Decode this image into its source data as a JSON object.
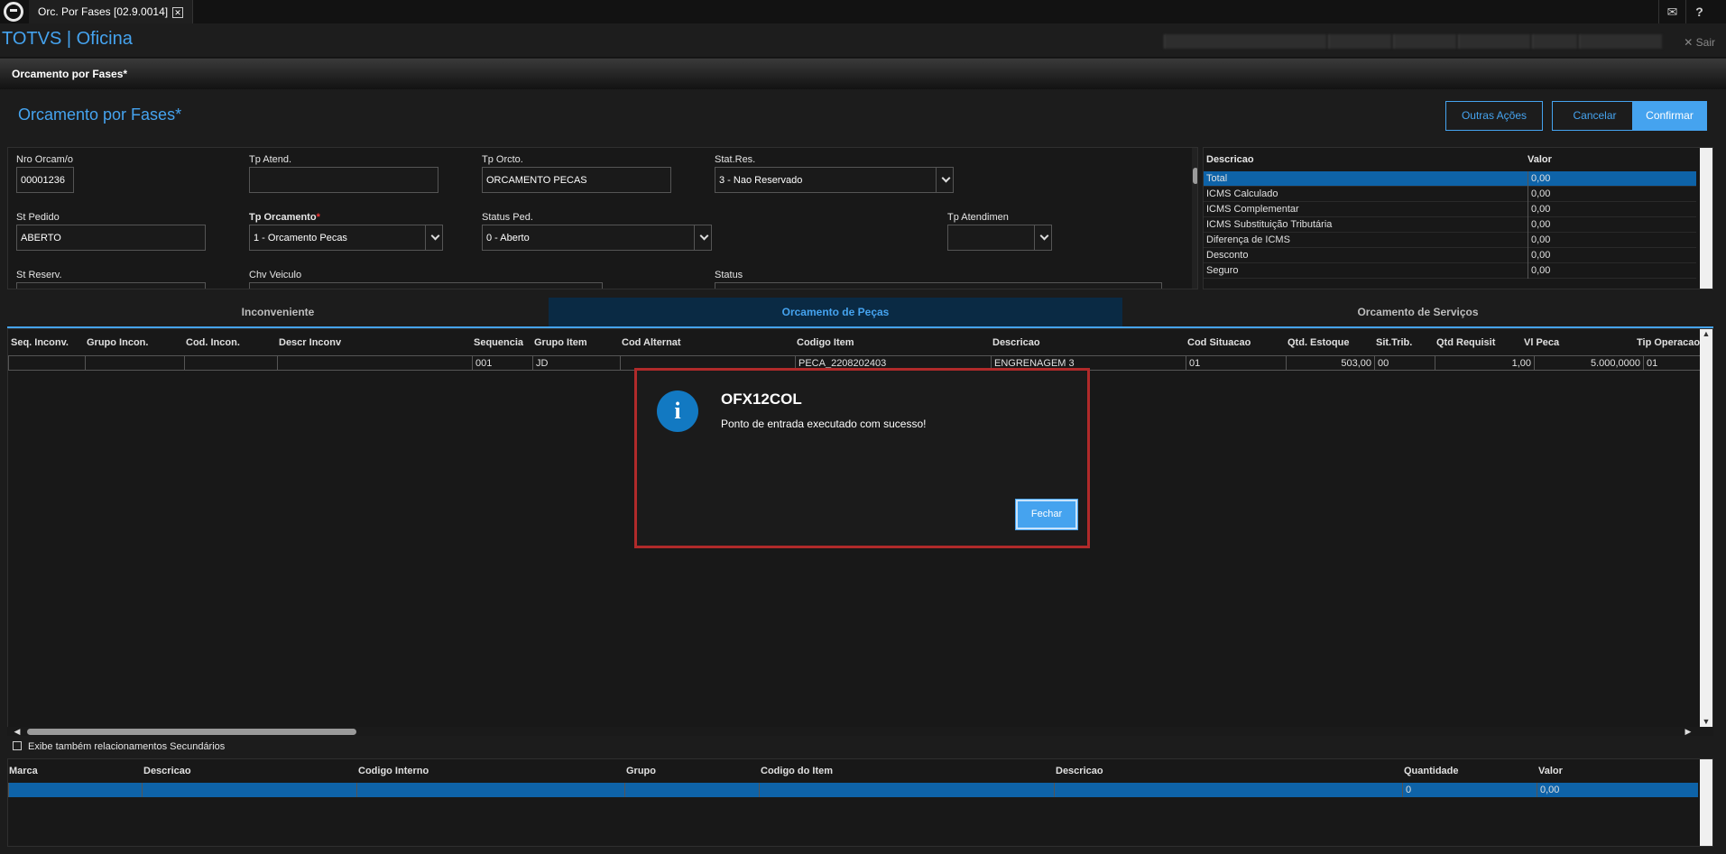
{
  "topbar": {
    "tab_title": "Orc. Por Fases [02.9.0014]",
    "close_glyph": "✕",
    "mail_glyph": "✉",
    "help_glyph": "?"
  },
  "brand": {
    "name": "TOTVS | Oficina",
    "exit_label": "Sair",
    "exit_glyph": "✕"
  },
  "page": {
    "header": "Orcamento por Fases*",
    "title": "Orcamento por Fases*"
  },
  "actions": {
    "other": "Outras Ações",
    "cancel": "Cancelar",
    "confirm": "Confirmar"
  },
  "form": {
    "nro_orcam_label": "Nro Orcam/o",
    "nro_orcam_value": "00001236",
    "tp_atend_label": "Tp Atend.",
    "tp_atend_value": "",
    "tp_orcto_label": "Tp Orcto.",
    "tp_orcto_value": "ORCAMENTO PECAS",
    "stat_res_label": "Stat.Res.",
    "stat_res_value": "3 - Nao Reservado",
    "st_pedido_label": "St Pedido",
    "st_pedido_value": "ABERTO",
    "tp_orcamento_label": "Tp Orcamento",
    "tp_orcamento_req": "*",
    "tp_orcamento_value": "1 - Orcamento Pecas",
    "status_ped_label": "Status Ped.",
    "status_ped_value": "0 - Aberto",
    "tp_atendimen_label": "Tp Atendimen",
    "tp_atendimen_value": "",
    "st_reserv_label": "St Reserv.",
    "chv_veiculo_label": "Chv Veiculo",
    "status_label": "Status"
  },
  "summary": {
    "col_desc": "Descricao",
    "col_val": "Valor",
    "rows": [
      {
        "desc": "Total",
        "val": "0,00"
      },
      {
        "desc": "ICMS Calculado",
        "val": "0,00"
      },
      {
        "desc": "ICMS Complementar",
        "val": "0,00"
      },
      {
        "desc": "ICMS Substituição Tributária",
        "val": "0,00"
      },
      {
        "desc": "Diferença de ICMS",
        "val": "0,00"
      },
      {
        "desc": "Desconto",
        "val": "0,00"
      },
      {
        "desc": "Seguro",
        "val": "0,00"
      }
    ]
  },
  "tabs": [
    "Inconveniente",
    "Orcamento de Peças",
    "Orcamento de Serviços"
  ],
  "grid1": {
    "headers": [
      "Seq. Inconv.",
      "Grupo Incon.",
      "Cod. Incon.",
      "Descr Inconv",
      "Sequencia",
      "Grupo Item",
      "Cod Alternat",
      "Codigo Item",
      "Descricao",
      "Cod Situacao",
      "Qtd. Estoque",
      "Sit.Trib.",
      "Qtd Requisit",
      "Vl Peca",
      "Tip Operacao"
    ],
    "row": [
      "",
      "",
      "",
      "",
      "001",
      "JD",
      "",
      "PECA_2208202403",
      "ENGRENAGEM 3",
      "01",
      "503,00",
      "00",
      "1,00",
      "5.000,0000",
      "01"
    ]
  },
  "secondary_label": "Exibe também relacionamentos Secundários",
  "grid2": {
    "headers": [
      "Marca",
      "Descricao",
      "Codigo Interno",
      "Grupo",
      "Codigo do Item",
      "Descricao",
      "Quantidade",
      "Valor"
    ],
    "row": [
      "",
      "",
      "",
      "",
      "",
      "",
      "0",
      "0,00"
    ]
  },
  "dialog": {
    "icon": "i",
    "title": "OFX12COL",
    "message": "Ponto de entrada executado com sucesso!",
    "button": "Fechar"
  }
}
